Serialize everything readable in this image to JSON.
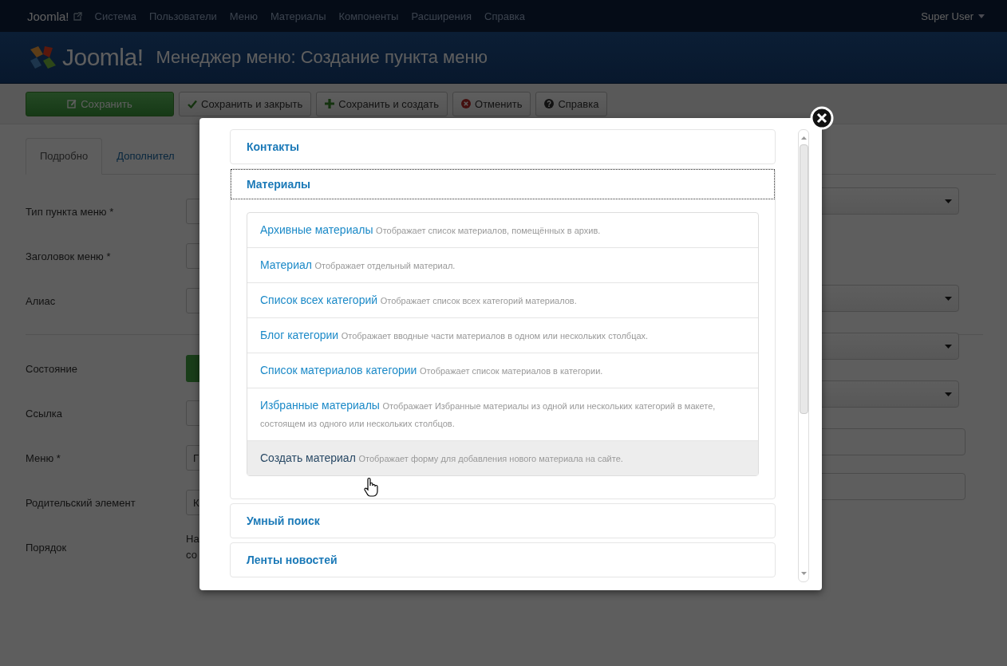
{
  "navbar": {
    "brand": "Joomla!",
    "menu": [
      "Система",
      "Пользователи",
      "Меню",
      "Материалы",
      "Компоненты",
      "Расширения",
      "Справка"
    ],
    "user": "Super User"
  },
  "header": {
    "logo": "Joomla!",
    "title": "Менеджер меню: Создание пункта меню"
  },
  "toolbar": [
    {
      "label": "Сохранить",
      "kind": "save"
    },
    {
      "label": "Сохранить и закрыть",
      "kind": "check"
    },
    {
      "label": "Сохранить и создать",
      "kind": "plus"
    },
    {
      "label": "Отменить",
      "kind": "cancel"
    },
    {
      "label": "Справка",
      "kind": "help"
    }
  ],
  "tabs": [
    {
      "label": "Подробно",
      "selected": true
    },
    {
      "label": "Дополнител",
      "selected": false
    }
  ],
  "form": [
    {
      "label": "Тип пункта меню *",
      "kind": "select"
    },
    {
      "label": "Заголовок меню *",
      "kind": "input"
    },
    {
      "label": "Алиас",
      "kind": "input"
    },
    {
      "label": "Состояние",
      "kind": "toggle",
      "separated": true,
      "on": true
    },
    {
      "label": "Ссылка",
      "kind": "input"
    },
    {
      "label": "Меню *",
      "kind": "select",
      "value": "Г"
    },
    {
      "label": "Родительский элемент",
      "kind": "select",
      "value": "К"
    },
    {
      "label": "Порядок",
      "kind": "text",
      "lines": [
        "На",
        "со"
      ]
    }
  ],
  "side_fields": [
    {
      "kind": "select"
    },
    {
      "kind": "select"
    },
    {
      "kind": "select"
    },
    {
      "kind": "select"
    },
    {
      "kind": "input"
    },
    {
      "kind": "input"
    }
  ],
  "modal": {
    "groups": [
      {
        "title": "Контакты",
        "expanded": false
      },
      {
        "title": "Материалы",
        "expanded": true,
        "items": [
          {
            "title": "Архивные материалы",
            "description": "Отображает список материалов, помещённых в архив.",
            "highlighted": false
          },
          {
            "title": "Материал",
            "description": "Отображает отдельный материал.",
            "highlighted": false
          },
          {
            "title": "Список всех категорий",
            "description": "Отображает список всех категорий материалов.",
            "highlighted": false
          },
          {
            "title": "Блог категории",
            "description": "Отображает вводные части материалов в одном или нескольких столбцах.",
            "highlighted": false
          },
          {
            "title": "Список материалов категории",
            "description": "Отображает список материалов в категории.",
            "highlighted": false
          },
          {
            "title": "Избранные материалы",
            "description": "Отображает Избранные материалы из одной или нескольких категорий в макете, состоящем из одного или нескольких столбцов.",
            "highlighted": false
          },
          {
            "title": "Создать материал",
            "description": "Отображает форму для добавления нового материала на сайте.",
            "highlighted": true
          }
        ]
      },
      {
        "title": "Умный поиск",
        "expanded": false
      },
      {
        "title": "Ленты новостей",
        "expanded": false
      }
    ]
  }
}
